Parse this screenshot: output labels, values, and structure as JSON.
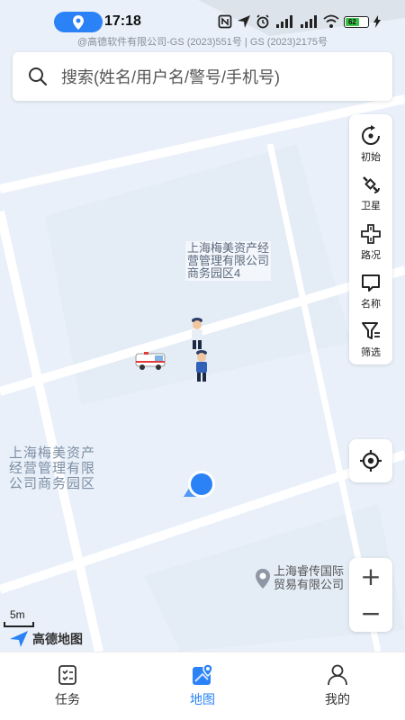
{
  "status_bar": {
    "time": "17:18",
    "battery": "62",
    "copyright": "@高德软件有限公司-GS (2023)551号 | GS (2023)2175号"
  },
  "search": {
    "placeholder": "搜索(姓名/用户名/警号/手机号)"
  },
  "toolbar": {
    "items": [
      {
        "label": "初始",
        "icon": "reset-icon"
      },
      {
        "label": "卫星",
        "icon": "satellite-icon"
      },
      {
        "label": "路况",
        "icon": "traffic-icon"
      },
      {
        "label": "名称",
        "icon": "name-icon"
      },
      {
        "label": "筛选",
        "icon": "filter-icon"
      }
    ]
  },
  "map": {
    "poi_building": "上海梅美资产经营管理有限公司商务园区4",
    "poi_building_lines": [
      "上海梅美资产经",
      "营管理有限公司",
      "商务园区4"
    ],
    "area_label_lines": [
      "上海梅美资产",
      "经营管理有限",
      "公司商务园区"
    ],
    "poi_company_lines": [
      "上海睿传国际",
      "贸易有限公司"
    ],
    "scale": "5m",
    "brand": "高德地图",
    "colors": {
      "accent": "#2a82f6",
      "map_bg": "#e9f0f9",
      "road": "#ffffff"
    }
  },
  "zoom": {
    "plus": "+",
    "minus": "−"
  },
  "bottom_nav": {
    "items": [
      {
        "label": "任务",
        "icon": "task-icon",
        "active": false
      },
      {
        "label": "地图",
        "icon": "map-icon",
        "active": true
      },
      {
        "label": "我的",
        "icon": "profile-icon",
        "active": false
      }
    ]
  }
}
